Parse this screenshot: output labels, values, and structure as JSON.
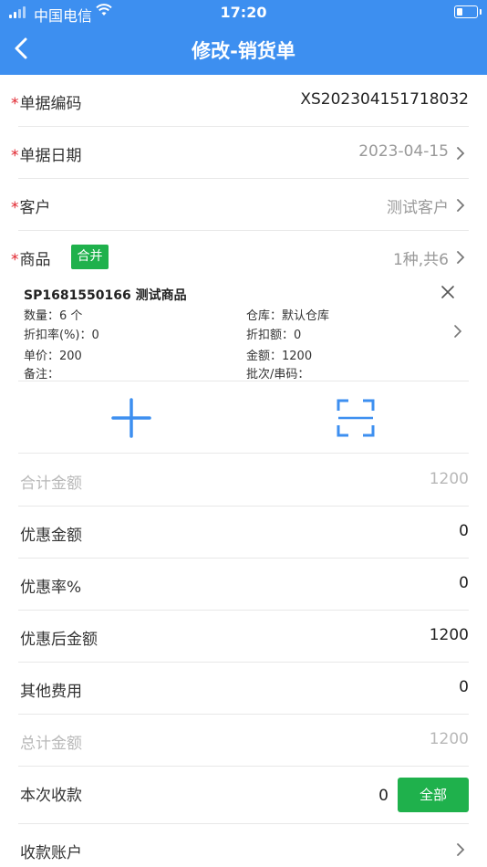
{
  "status_bar": {
    "carrier": "中国电信",
    "time": "17:20",
    "battery_level": 0.35
  },
  "nav": {
    "title": "修改-销货单"
  },
  "form": {
    "doc_no": {
      "label": "单据编码",
      "value": "XS20230415171803​2"
    },
    "doc_date": {
      "label": "单据日期",
      "value": "2023-04-15"
    },
    "customer": {
      "label": "客户",
      "value": "测试客户"
    },
    "goods": {
      "label": "商品",
      "merge_label": "合并",
      "summary": "1种,共6"
    }
  },
  "product": {
    "code_name": "SP1681550166 测试商品",
    "qty": "数量：6 个",
    "warehouse": "仓库：默认仓库",
    "discount_rate": "折扣率(%)：0",
    "discount_amount": "折扣额：0",
    "unit_price": "单价：200",
    "amount": "金额：1200",
    "remark": "备注：",
    "batch": "批次/串码："
  },
  "totals": {
    "subtotal": {
      "label": "合计金额",
      "value": "1200"
    },
    "discount": {
      "label": "优惠金额",
      "value": "0"
    },
    "discount_rate": {
      "label": "优惠率%",
      "value": "0"
    },
    "after_discount": {
      "label": "优惠后金额",
      "value": "1200"
    },
    "other_fees": {
      "label": "其他费用",
      "value": "0"
    },
    "grand_total": {
      "label": "总计金额",
      "value": "1200"
    },
    "received": {
      "label": "本次收款",
      "value": "0",
      "all_button": "全部"
    },
    "account": {
      "label": "收款账户"
    }
  },
  "colors": {
    "header": "#3d8ff0",
    "required": "#e0222b",
    "button_green": "#1fb14c",
    "icon_blue": "#3d8ff0"
  },
  "icons": [
    "back-arrow-icon",
    "chevron-right-icon",
    "close-icon",
    "plus-icon",
    "scan-icon",
    "wifi-icon",
    "battery-icon"
  ]
}
